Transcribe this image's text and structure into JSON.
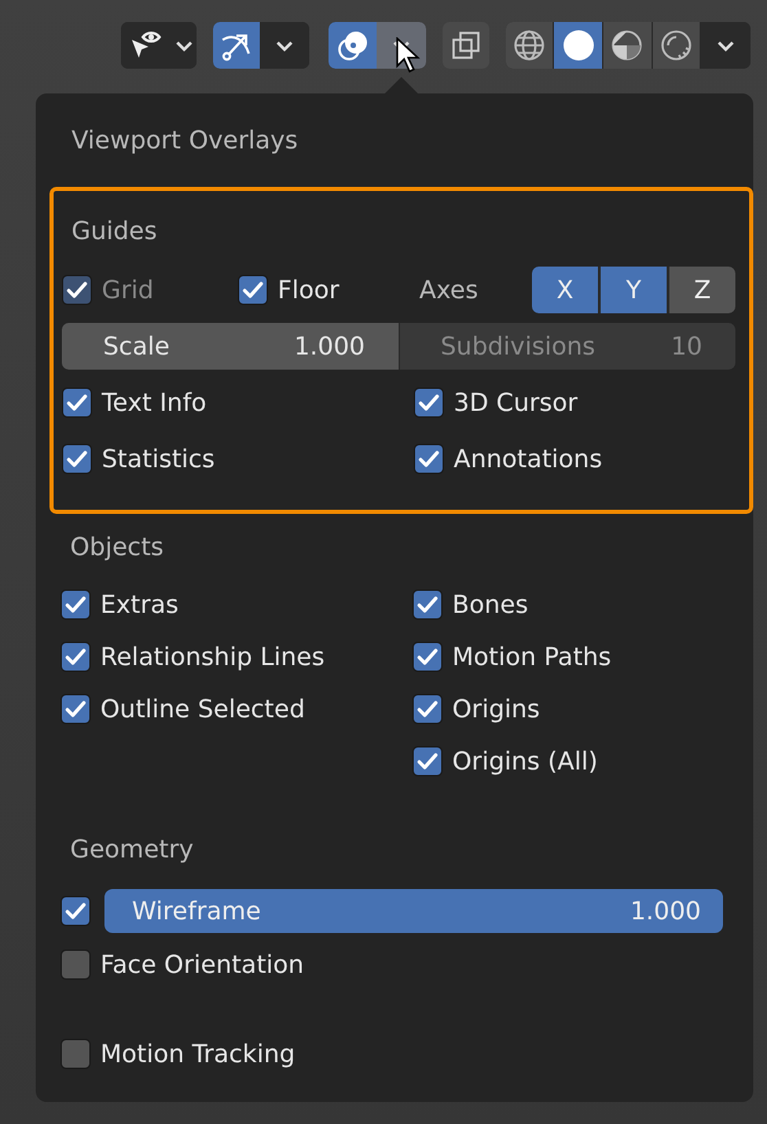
{
  "toolbar": {
    "gizmos_on": true,
    "overlays_on": true,
    "overlay_menu_open": true,
    "xray_on": false,
    "shading": [
      {
        "kind": "wireframe",
        "selected": false
      },
      {
        "kind": "solid",
        "selected": true
      },
      {
        "kind": "material",
        "selected": false
      },
      {
        "kind": "rendered",
        "selected": false
      }
    ]
  },
  "panel": {
    "title": "Viewport Overlays",
    "guides": {
      "title": "Guides",
      "highlighted": true,
      "grid": {
        "label": "Grid",
        "checked": true,
        "disabled": true
      },
      "floor": {
        "label": "Floor",
        "checked": true,
        "disabled": false
      },
      "axes": {
        "label": "Axes",
        "buttons": [
          {
            "label": "X",
            "selected": true
          },
          {
            "label": "Y",
            "selected": true
          },
          {
            "label": "Z",
            "selected": false
          }
        ]
      },
      "scale": {
        "label": "Scale",
        "value": "1.000",
        "disabled": false
      },
      "subdivisions": {
        "label": "Subdivisions",
        "value": "10",
        "disabled": true
      },
      "toggles": [
        {
          "label": "Text Info",
          "checked": true
        },
        {
          "label": "3D Cursor",
          "checked": true
        },
        {
          "label": "Statistics",
          "checked": true
        },
        {
          "label": "Annotations",
          "checked": true
        }
      ]
    },
    "objects": {
      "title": "Objects",
      "left": [
        {
          "label": "Extras",
          "checked": true
        },
        {
          "label": "Relationship Lines",
          "checked": true
        },
        {
          "label": "Outline Selected",
          "checked": true
        }
      ],
      "right": [
        {
          "label": "Bones",
          "checked": true
        },
        {
          "label": "Motion Paths",
          "checked": true
        },
        {
          "label": "Origins",
          "checked": true
        },
        {
          "label": "Origins (All)",
          "checked": true
        }
      ]
    },
    "geometry": {
      "title": "Geometry",
      "wireframe": {
        "checked": true,
        "label": "Wireframe",
        "value": "1.000",
        "level": 1
      },
      "toggles": [
        {
          "label": "Face Orientation",
          "checked": false
        }
      ]
    },
    "motion_tracking": {
      "label": "Motion Tracking",
      "checked": false
    }
  }
}
